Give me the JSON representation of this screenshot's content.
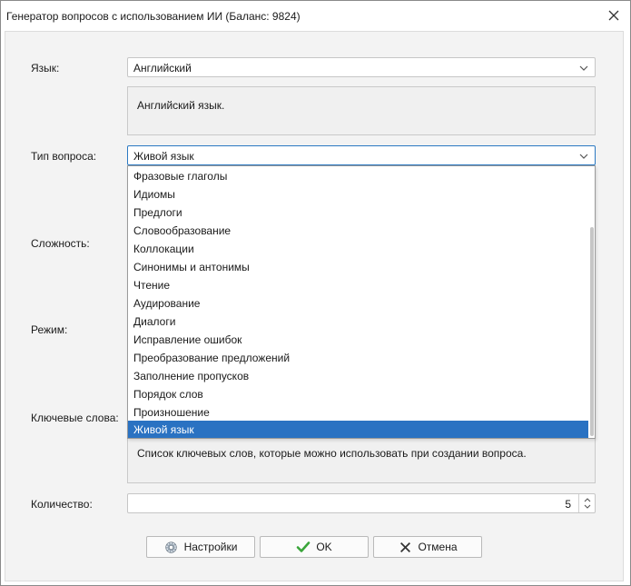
{
  "window": {
    "title": "Генератор вопросов с использованием ИИ (Баланс: 9824)"
  },
  "form": {
    "language_label": "Язык:",
    "language_value": "Английский",
    "language_description": "Английский язык.",
    "question_type_label": "Тип вопроса:",
    "question_type_value": "Живой язык",
    "difficulty_label": "Сложность:",
    "mode_label": "Режим:",
    "keywords_label": "Ключевые слова:",
    "keywords_description": "Список ключевых слов, которые можно использовать при создании вопроса.",
    "quantity_label": "Количество:",
    "quantity_value": "5"
  },
  "dropdown": {
    "items": [
      "Фразовые глаголы",
      "Идиомы",
      "Предлоги",
      "Словообразование",
      "Коллокации",
      "Синонимы и антонимы",
      "Чтение",
      "Аудирование",
      "Диалоги",
      "Исправление ошибок",
      "Преобразование предложений",
      "Заполнение пропусков",
      "Порядок слов",
      "Произношение",
      "Живой язык"
    ],
    "selected_index": 14
  },
  "buttons": {
    "settings": "Настройки",
    "ok": "OK",
    "cancel": "Отмена"
  },
  "colors": {
    "selection": "#2a72c2",
    "ok_check": "#3aa53a",
    "focus_border": "#2b79c2"
  },
  "icons": {
    "close": "close-icon",
    "chevron": "chevron-down-icon",
    "settings": "gear-icon",
    "ok": "checkmark-icon",
    "cancel": "x-icon"
  }
}
